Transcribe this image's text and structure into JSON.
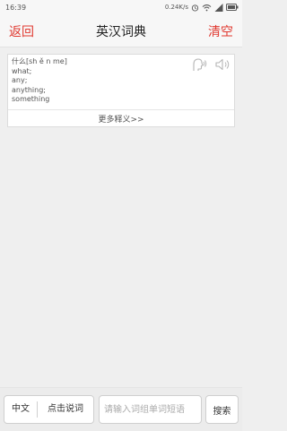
{
  "status_bar": {
    "time": "16:39",
    "speed": "0.24K/s",
    "icons": [
      "alarm-icon",
      "wifi-icon",
      "signal-icon",
      "battery-icon"
    ]
  },
  "header": {
    "back_label": "返回",
    "title": "英汉词典",
    "clear_label": "清空"
  },
  "result": {
    "lines": [
      "什么[sh ě n me]",
      "what;",
      "any;",
      "anything;",
      "something"
    ],
    "more_label": "更多释义>>",
    "icons": [
      "speak-person-icon",
      "speaker-icon"
    ]
  },
  "bottom_bar": {
    "lang_label": "中文",
    "voice_label": "点击说词",
    "search_placeholder": "请输入词组单词短语",
    "search_value": "",
    "search_button_label": "搜索"
  },
  "colors": {
    "accent": "#e0382f",
    "background": "#efefef",
    "card": "#ffffff"
  }
}
